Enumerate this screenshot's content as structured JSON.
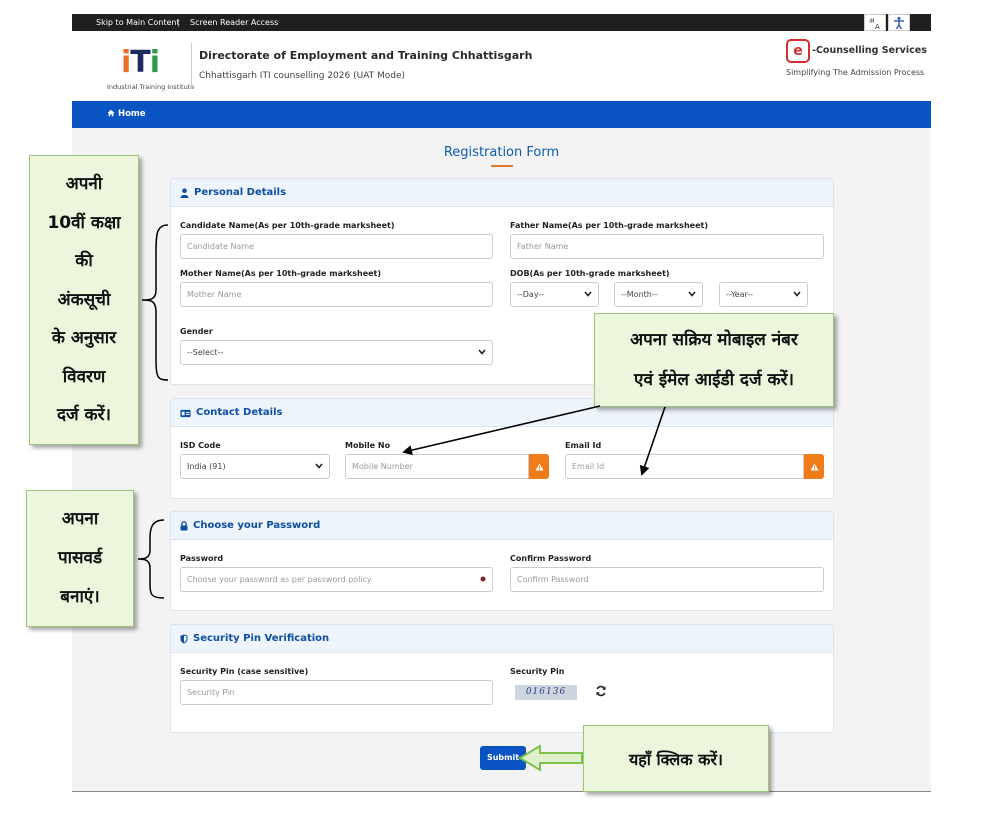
{
  "topbar": {
    "skip": "Skip to Main Content",
    "separator": "|",
    "screen_reader": "Screen Reader Access",
    "lang_icon_label": "अ",
    "lang_icon_label2": "A"
  },
  "header": {
    "logo_text": "ITI",
    "logo_caption": "Industrial Training Institute",
    "title": "Directorate of Employment and Training Chhattisgarh",
    "subtitle": "Chhattisgarh ITI counselling 2026 (UAT Mode)",
    "partner_mark": "e",
    "partner_title": "-Counselling Services",
    "partner_tagline": "Simplifying The Admission Process"
  },
  "nav": {
    "home": "Home"
  },
  "form": {
    "title": "Registration Form",
    "personal": {
      "heading": "Personal Details",
      "candidate_label": "Candidate Name(As per 10th-grade marksheet)",
      "candidate_placeholder": "Candidate Name",
      "father_label": "Father Name(As per 10th-grade marksheet)",
      "father_placeholder": "Father Name",
      "mother_label": "Mother Name(As per 10th-grade marksheet)",
      "mother_placeholder": "Mother Name",
      "dob_label": "DOB(As per 10th-grade marksheet)",
      "day": "--Day--",
      "month": "--Month--",
      "year": "--Year--",
      "gender_label": "Gender",
      "gender_value": "--Select--"
    },
    "contact": {
      "heading": "Contact Details",
      "isd_label": "ISD Code",
      "isd_value": "India (91)",
      "mobile_label": "Mobile No",
      "mobile_placeholder": "Mobile Number",
      "email_label": "Email Id",
      "email_placeholder": "Email Id"
    },
    "password": {
      "heading": "Choose your Password",
      "password_label": "Password",
      "password_placeholder": "Choose your password as per password policy",
      "confirm_label": "Confirm Password",
      "confirm_placeholder": "Confirm Password"
    },
    "security": {
      "heading": "Security Pin Verification",
      "pin_label": "Security Pin (case sensitive)",
      "pin_placeholder": "Security Pin",
      "captcha_label": "Security Pin",
      "captcha_value": "016136"
    },
    "submit": "Submit"
  },
  "annotations": {
    "personal_note": [
      "अपनी",
      "10वीं कक्षा",
      "की",
      "अंकसूची",
      "के अनुसार",
      "विवरण",
      "दर्ज करें।"
    ],
    "contact_note": [
      "अपना सक्रिय मोबाइल नंबर",
      "एवं ईमेल आईडी दर्ज करें।"
    ],
    "password_note": [
      "अपना",
      "पासवर्ड",
      "बनाएं।"
    ],
    "submit_note": "यहाँ क्लिक करें।"
  },
  "colors": {
    "primary_blue": "#0a53c2",
    "warning_orange": "#f07c19",
    "callout_bg": "#ebf6dd",
    "arrow_green": "#7fc04a"
  }
}
